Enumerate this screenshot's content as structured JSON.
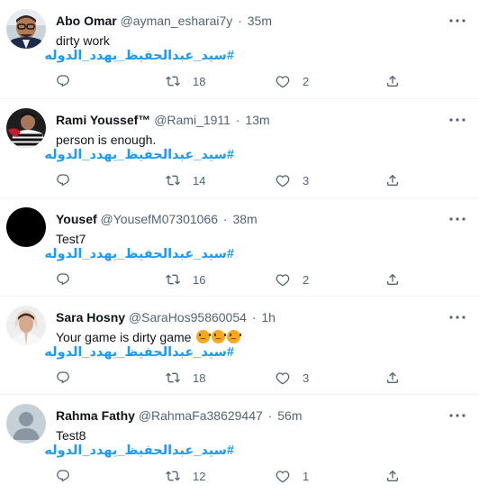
{
  "tweets": [
    {
      "name": "Abo Omar",
      "handle": "@ayman_esharai7y",
      "separator": "·",
      "time": "35m",
      "text": "dirty work",
      "hashtag": "#سيد_عبدالحفيظ_يهدد_الدوله",
      "retweets": "18",
      "likes": "2",
      "avatar": "photo-man-glasses"
    },
    {
      "name": "Rami Youssef™",
      "handle": "@Rami_1911",
      "separator": "·",
      "time": "13m",
      "text": "person is enough.",
      "hashtag": "#سيد_عبدالحفيظ_يهدد_الدوله",
      "retweets": "14",
      "likes": "3",
      "avatar": "photo-striped-jersey"
    },
    {
      "name": "Yousef",
      "handle": "@YousefM07301066",
      "separator": "·",
      "time": "38m",
      "text": "Test7",
      "hashtag": "#سيد_عبدالحفيظ_يهدد_الدوله",
      "retweets": "16",
      "likes": "2",
      "avatar": "black-circle"
    },
    {
      "name": "Sara Hosny",
      "handle": "@SaraHos95860054",
      "separator": "·",
      "time": "1h",
      "text": "Your game is dirty game",
      "emojis": [
        "angry-face-emoji",
        "angry-face-emoji",
        "angry-face-emoji"
      ],
      "hashtag": "#سيد_عبدالحفيظ_يهدد_الدوله",
      "retweets": "18",
      "likes": "3",
      "avatar": "photo-woman"
    },
    {
      "name": "Rahma Fathy",
      "handle": "@RahmaFa38629447",
      "separator": "·",
      "time": "56m",
      "text": "Test8",
      "hashtag": "#سيد_عبدالحفيظ_يهدد_الدوله",
      "retweets": "12",
      "likes": "1",
      "avatar": "default-profile"
    }
  ],
  "colors": {
    "link": "#1d9bf0",
    "secondary_text": "#536471",
    "divider": "#eff3f4"
  }
}
